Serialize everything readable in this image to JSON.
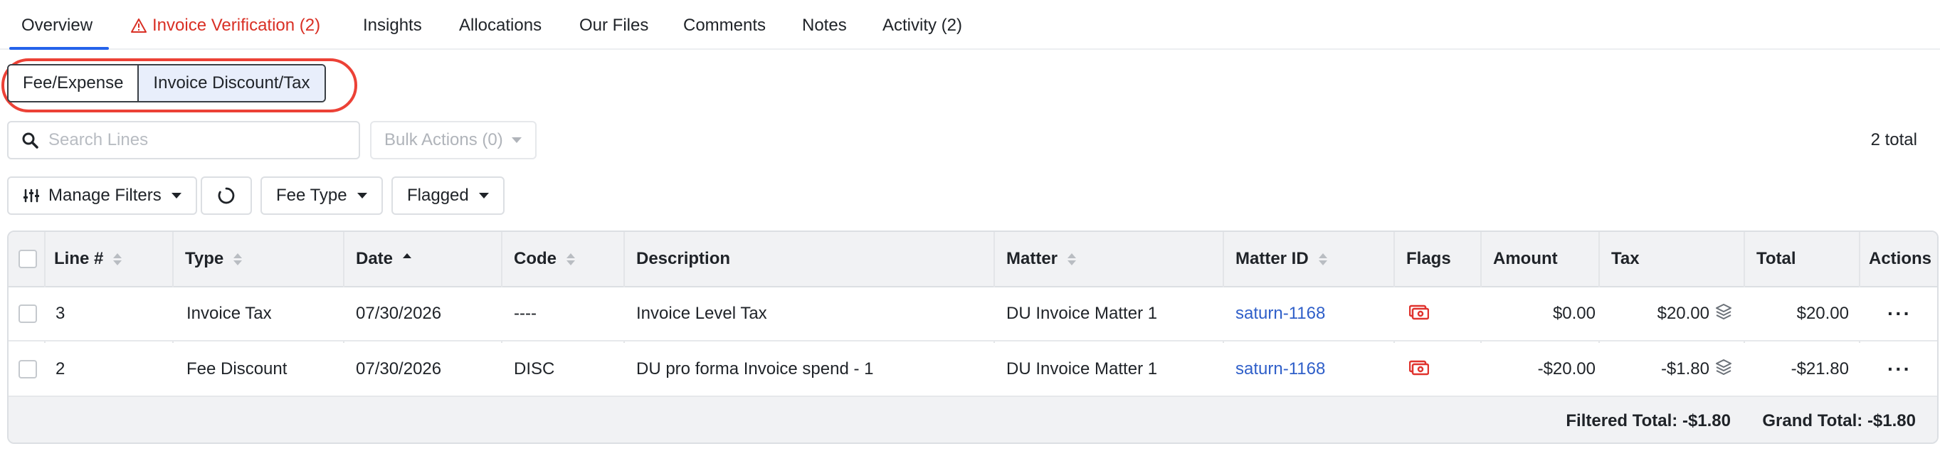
{
  "tabs": [
    {
      "label": "Overview",
      "active": true
    },
    {
      "label": "Invoice Verification (2)",
      "warning": true
    },
    {
      "label": "Insights"
    },
    {
      "label": "Allocations"
    },
    {
      "label": "Our Files"
    },
    {
      "label": "Comments"
    },
    {
      "label": "Notes"
    },
    {
      "label": "Activity (2)"
    }
  ],
  "line_type_toggle": {
    "options": [
      "Fee/Expense",
      "Invoice Discount/Tax"
    ],
    "selected": "Invoice Discount/Tax"
  },
  "search": {
    "placeholder": "Search Lines",
    "value": "",
    "icon": "search-icon"
  },
  "bulk_actions": {
    "label": "Bulk Actions (0)",
    "disabled": true
  },
  "total_count": "2 total",
  "filters": {
    "manage_filters": "Manage Filters",
    "fee_type": "Fee Type",
    "flagged": "Flagged"
  },
  "table": {
    "columns": [
      "Line #",
      "Type",
      "Date",
      "Code",
      "Description",
      "Matter",
      "Matter ID",
      "Flags",
      "Amount",
      "Tax",
      "Total",
      "Actions"
    ],
    "sorted_column": "Date",
    "sort_direction": "ascending",
    "rows": [
      {
        "line": "3",
        "type": "Invoice Tax",
        "date": "07/30/2026",
        "code": "----",
        "description": "Invoice Level Tax",
        "matter": "DU Invoice Matter 1",
        "matter_id": "saturn-1168",
        "flag_icon": "money-flag-icon",
        "amount": "$0.00",
        "tax": "$20.00",
        "total": "$20.00"
      },
      {
        "line": "2",
        "type": "Fee Discount",
        "date": "07/30/2026",
        "code": "DISC",
        "description": "DU pro forma Invoice spend - 1",
        "matter": "DU Invoice Matter 1",
        "matter_id": "saturn-1168",
        "flag_icon": "money-flag-icon",
        "amount": "-$20.00",
        "tax": "-$1.80",
        "total": "-$21.80"
      }
    ],
    "footer": {
      "filtered_total": "Filtered Total: -$1.80",
      "grand_total": "Grand Total: -$1.80"
    }
  },
  "colors": {
    "accent": "#2563eb",
    "warning": "#d93025",
    "highlight_ring": "#ec4136",
    "link": "#2f5fc9",
    "flag": "#e0332e",
    "selected_segment": "#e8eefb"
  }
}
